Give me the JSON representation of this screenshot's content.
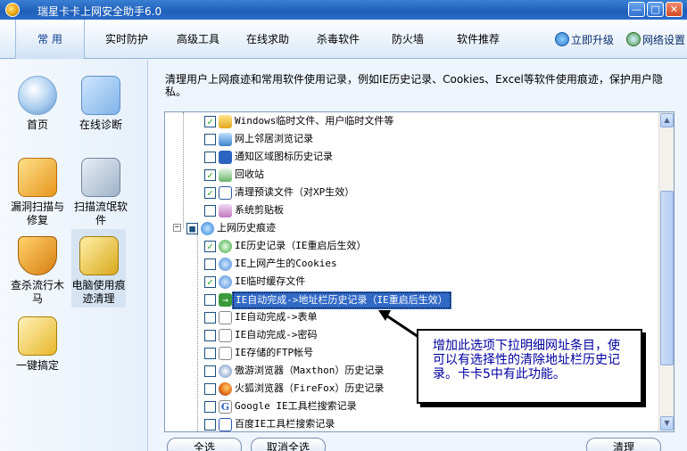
{
  "window": {
    "title": "瑞星卡卡上网安全助手6.0",
    "min": "—",
    "max": "□",
    "close": "✕"
  },
  "tabs": [
    {
      "label": "常 用",
      "active": true
    },
    {
      "label": "实时防护"
    },
    {
      "label": "高级工具"
    },
    {
      "label": "在线求助"
    },
    {
      "label": "杀毒软件"
    },
    {
      "label": "防火墙"
    },
    {
      "label": "软件推荐"
    }
  ],
  "top_links": {
    "upgrade": "立即升级",
    "network": "网络设置"
  },
  "sidebar": [
    {
      "label": "首页",
      "icon": "home-icon"
    },
    {
      "label": "在线诊断",
      "icon": "diagnose-icon"
    },
    {
      "label": "漏洞扫描与修复",
      "icon": "vulnerability-scan-icon"
    },
    {
      "label": "扫描流氓软件",
      "icon": "malware-scan-icon"
    },
    {
      "label": "查杀流行木马",
      "icon": "trojan-kill-icon"
    },
    {
      "label": "电脑使用痕迹清理",
      "icon": "broom-icon",
      "selected": true
    },
    {
      "label": "一键搞定",
      "icon": "one-click-icon"
    }
  ],
  "description": "清理用户上网痕迹和常用软件使用记录，例如IE历史记录、Cookies、Excel等软件使用痕迹，保护用户隐私。",
  "list_items": [
    {
      "label": "Windows临时文件、用户临时文件等",
      "checked": true,
      "level": 2,
      "icon": "folder-icon"
    },
    {
      "label": "网上邻居浏览记录",
      "checked": false,
      "level": 2,
      "icon": "network-neighborhood-icon"
    },
    {
      "label": "通知区域图标历史记录",
      "checked": false,
      "level": 2,
      "icon": "tray-icon"
    },
    {
      "label": "回收站",
      "checked": true,
      "level": 2,
      "icon": "recycle-bin-icon"
    },
    {
      "label": "清理预读文件（对XP生效）",
      "checked": true,
      "level": 2,
      "icon": "window-icon"
    },
    {
      "label": "系统剪贴板",
      "checked": false,
      "level": 2,
      "icon": "clipboard-icon"
    },
    {
      "label": "上网历史痕迹",
      "checked": "partial",
      "level": 1,
      "icon": "ie-icon",
      "group": true
    },
    {
      "label": "IE历史记录（IE重启后生效）",
      "checked": true,
      "level": 2,
      "icon": "ie-history-icon"
    },
    {
      "label": "IE上网产生的Cookies",
      "checked": false,
      "level": 2,
      "icon": "cookies-icon"
    },
    {
      "label": "IE临时缓存文件",
      "checked": true,
      "level": 2,
      "icon": "cache-icon"
    },
    {
      "label": "IE自动完成->地址栏历史记录（IE重启后生效）",
      "checked": false,
      "level": 2,
      "icon": "arrow-right-icon",
      "highlighted": true
    },
    {
      "label": "IE自动完成->表单",
      "checked": false,
      "level": 2,
      "icon": "form-icon"
    },
    {
      "label": "IE自动完成->密码",
      "checked": false,
      "level": 2,
      "icon": "password-icon"
    },
    {
      "label": "IE存储的FTP帐号",
      "checked": false,
      "level": 2,
      "icon": "ftp-icon"
    },
    {
      "label": "傲游浏览器（Maxthon）历史记录",
      "checked": false,
      "level": 2,
      "icon": "maxthon-icon"
    },
    {
      "label": "火狐浏览器（FireFox）历史记录",
      "checked": false,
      "level": 2,
      "icon": "firefox-icon"
    },
    {
      "label": "Google IE工具栏搜索记录",
      "checked": false,
      "level": 2,
      "icon": "google-icon"
    },
    {
      "label": "百度IE工具栏搜索记录",
      "checked": false,
      "level": 2,
      "icon": "baidu-icon"
    }
  ],
  "buttons": {
    "select_all": "全选",
    "deselect_all": "取消全选",
    "clean": "清理"
  },
  "callout": {
    "text": "增加此选项下拉明细网址条目，使可以有选择性的清除地址栏历史记录。卡卡5中有此功能。"
  },
  "colors": {
    "accent": "#3169c6",
    "titlebar": "#1f5fb8",
    "callout_text": "#0000a0"
  }
}
